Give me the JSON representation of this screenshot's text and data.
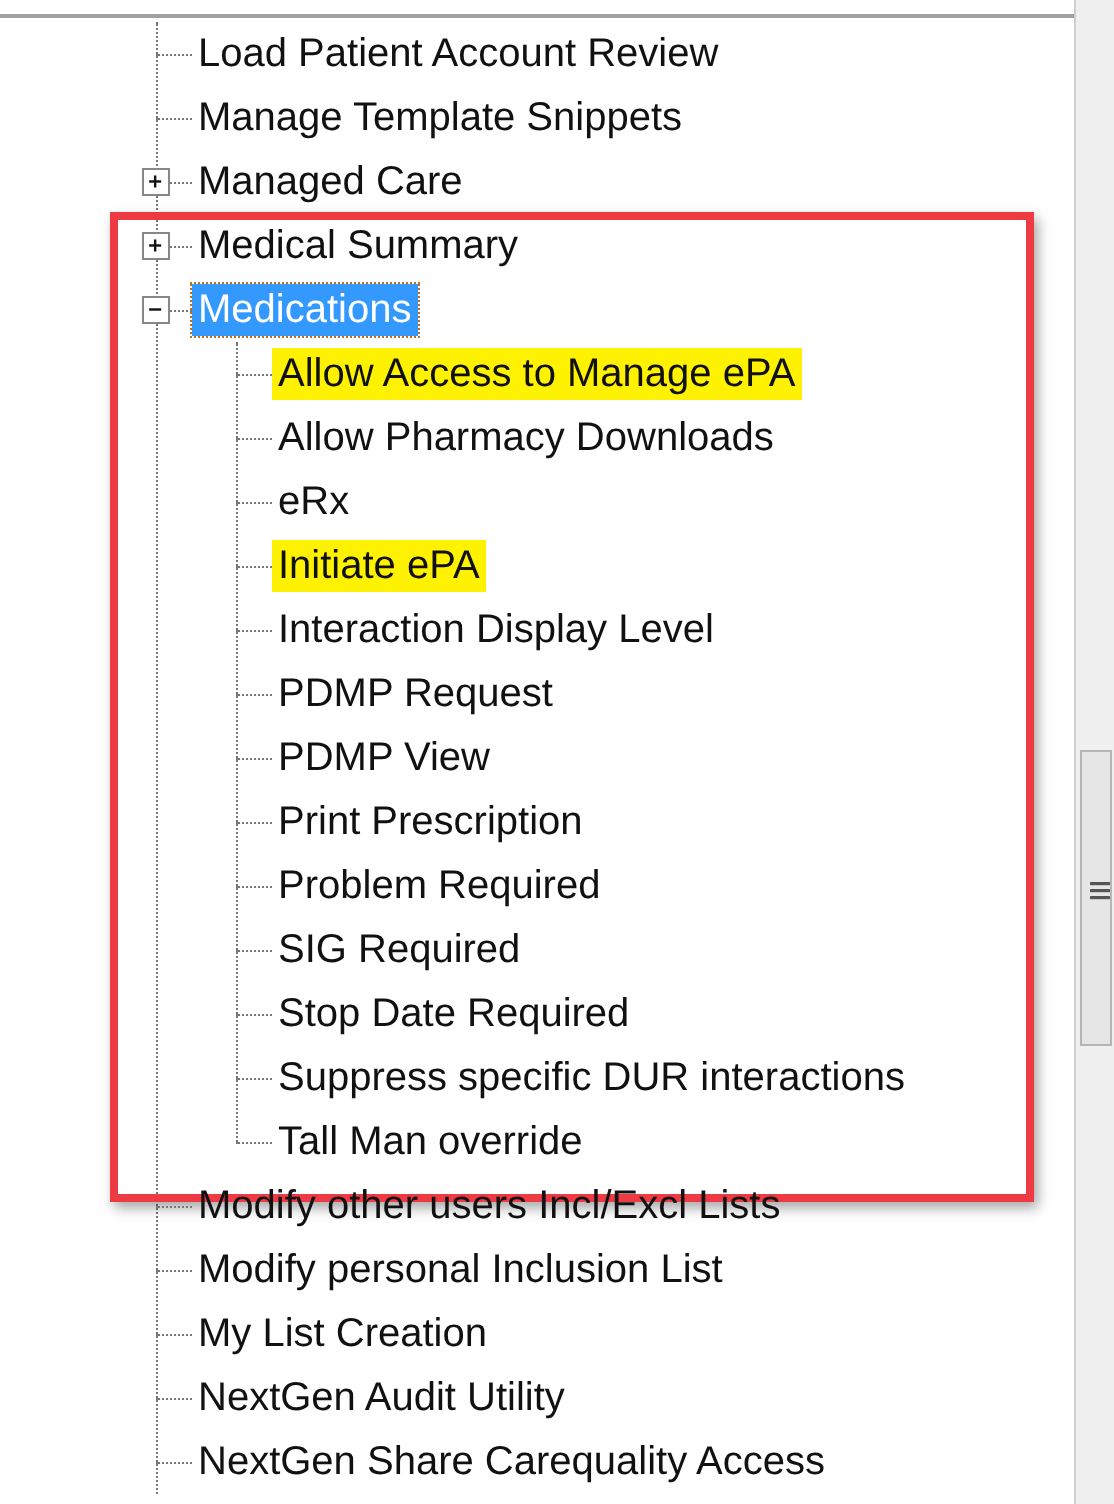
{
  "tree": [
    {
      "label": "Load Patient Account Review",
      "selected": false,
      "highlighted": false
    },
    {
      "label": "Manage Template Snippets",
      "selected": false,
      "highlighted": false
    },
    {
      "label": "Managed Care",
      "selected": false,
      "highlighted": false,
      "expanded": false
    },
    {
      "label": "Medical Summary",
      "selected": false,
      "highlighted": false,
      "expanded": false
    },
    {
      "label": "Medications",
      "selected": true,
      "highlighted": false,
      "expanded": true,
      "outlined": true,
      "children": [
        {
          "label": "Allow Access to Manage ePA",
          "selected": false,
          "highlighted": true
        },
        {
          "label": "Allow Pharmacy Downloads",
          "selected": false,
          "highlighted": false
        },
        {
          "label": "eRx",
          "selected": false,
          "highlighted": false
        },
        {
          "label": "Initiate ePA",
          "selected": false,
          "highlighted": true
        },
        {
          "label": "Interaction Display Level",
          "selected": false,
          "highlighted": false
        },
        {
          "label": "PDMP Request",
          "selected": false,
          "highlighted": false
        },
        {
          "label": "PDMP View",
          "selected": false,
          "highlighted": false
        },
        {
          "label": "Print Prescription",
          "selected": false,
          "highlighted": false
        },
        {
          "label": "Problem Required",
          "selected": false,
          "highlighted": false
        },
        {
          "label": "SIG Required",
          "selected": false,
          "highlighted": false
        },
        {
          "label": "Stop Date Required",
          "selected": false,
          "highlighted": false
        },
        {
          "label": "Suppress specific DUR interactions",
          "selected": false,
          "highlighted": false
        },
        {
          "label": "Tall Man override",
          "selected": false,
          "highlighted": false
        }
      ]
    },
    {
      "label": "Modify other users Incl/Excl Lists",
      "selected": false,
      "highlighted": false
    },
    {
      "label": "Modify personal Inclusion List",
      "selected": false,
      "highlighted": false
    },
    {
      "label": "My List Creation",
      "selected": false,
      "highlighted": false
    },
    {
      "label": "NextGen Audit Utility",
      "selected": false,
      "highlighted": false
    },
    {
      "label": "NextGen Share Carequality Access",
      "selected": false,
      "highlighted": false
    }
  ]
}
